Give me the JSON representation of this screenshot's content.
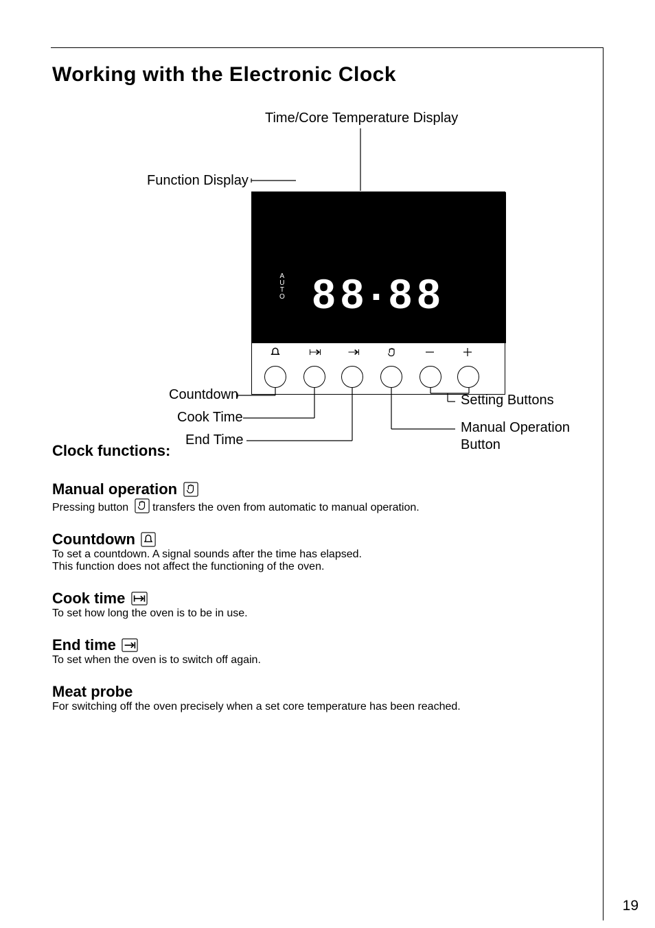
{
  "page": {
    "number": "19"
  },
  "heading": "Working with the Electronic Clock",
  "diagram": {
    "time_core": "Time/Core Temperature Display",
    "func_display": "Function Display",
    "digits": "88.88",
    "auto": "A\nU\nT\nO",
    "countdown": "Countdown",
    "cook_time": "Cook Time",
    "end_time": "End Time",
    "setting_buttons": "Setting Buttons",
    "manual_op1": "Manual Operation",
    "manual_op2": "Button"
  },
  "clock_functions_heading": "Clock functions:",
  "manual_operation": {
    "title": "Manual operation",
    "body_before": "Pressing button ",
    "body_after": " transfers the oven from automatic to manual operation."
  },
  "countdown": {
    "title": "Countdown",
    "body": "To set a countdown. A signal sounds after the time has elapsed.\nThis function does not affect the functioning of the oven."
  },
  "cook_time": {
    "title": "Cook time",
    "body": "To set how long the oven is to be in use."
  },
  "end_time": {
    "title": "End time",
    "body": "To set when the oven is to switch off again."
  },
  "meat_probe": {
    "title": "Meat probe",
    "body": "For switching off the oven precisely when a set core temperature has been reached."
  }
}
